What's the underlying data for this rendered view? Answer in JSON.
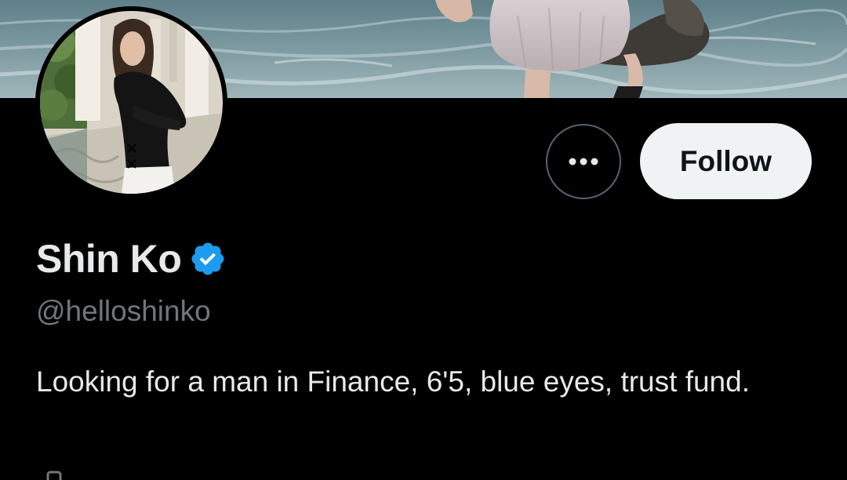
{
  "profile": {
    "display_name": "Shin Ko",
    "handle": "@helloshinko",
    "bio": "Looking for a man in Finance, 6'5, blue eyes, trust fund.",
    "verified": true
  },
  "actions": {
    "more_icon": "more-horizontal-icon",
    "follow_label": "Follow"
  },
  "colors": {
    "background": "#000000",
    "verified_blue": "#1d9bf0",
    "primary_text": "#e7e9ea",
    "secondary_text": "#71767b",
    "follow_bg": "#eff3f4",
    "button_border": "#536471"
  }
}
